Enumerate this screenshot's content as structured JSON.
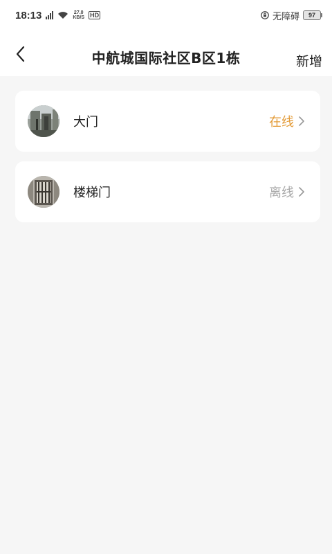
{
  "status_bar": {
    "time": "18:13",
    "net_speed_value": "27.0",
    "net_speed_unit": "KB/S",
    "hd_label": "HD",
    "accessibility_label": "无障碍",
    "battery_level": "97"
  },
  "nav": {
    "title": "中航城国际社区B区1栋",
    "action_label": "新增"
  },
  "doors": [
    {
      "name": "大门",
      "status": "在线",
      "status_color": "#e39a35",
      "avatar": "door-photo-1"
    },
    {
      "name": "楼梯门",
      "status": "离线",
      "status_color": "#aaaaaa",
      "avatar": "door-photo-2"
    }
  ],
  "colors": {
    "background": "#f6f6f6",
    "card": "#ffffff",
    "online": "#e39a35",
    "offline": "#aaaaaa"
  }
}
